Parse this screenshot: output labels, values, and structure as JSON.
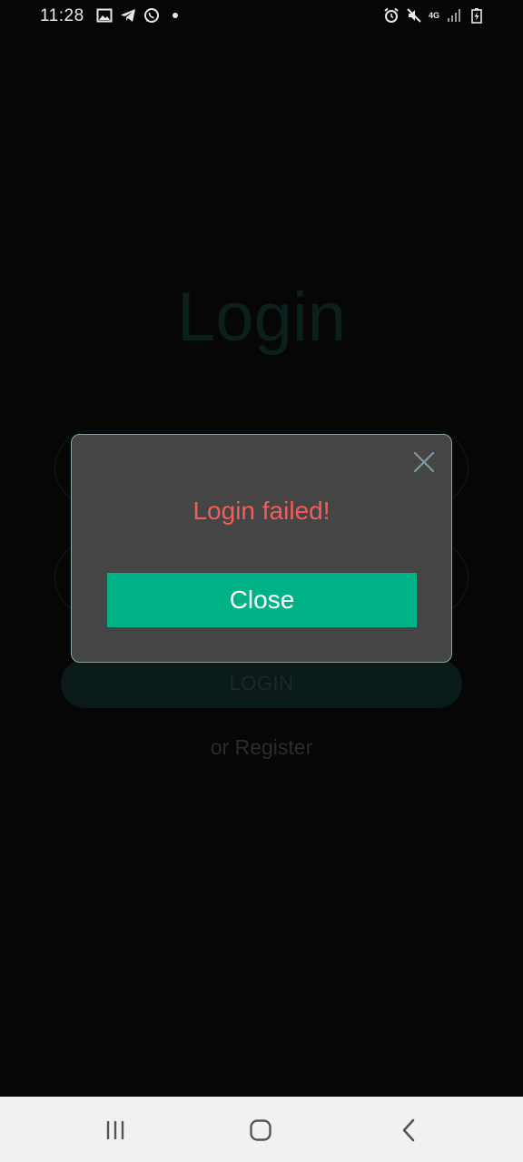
{
  "status_bar": {
    "time": "11:28",
    "network_type": "4G",
    "left_icons": [
      "gallery-icon",
      "telegram-icon",
      "whatsapp-icon",
      "notification-dot"
    ],
    "right_icons": [
      "alarm-icon",
      "mute-icon",
      "4g-icon",
      "signal-icon",
      "battery-charging-icon"
    ]
  },
  "background_screen": {
    "title": "Login",
    "login_button_label": "LOGIN",
    "register_link": "or Register"
  },
  "dialog": {
    "message": "Login failed!",
    "close_button_label": "Close"
  },
  "nav_bar": {
    "buttons": [
      "recent-apps-button",
      "home-button",
      "back-button"
    ]
  },
  "colors": {
    "accent": "#00b386",
    "error_text": "#f25c5c",
    "dialog_bg": "#454545",
    "dialog_border": "#8a9ea6",
    "background": "#060606",
    "nav_bar_bg": "#f1f1f1"
  }
}
